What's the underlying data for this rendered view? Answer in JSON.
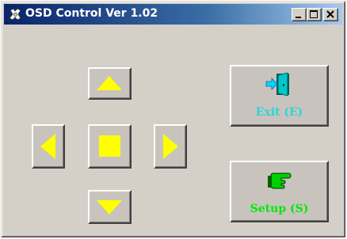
{
  "window": {
    "title": "OSD Control  Ver 1.02",
    "icon": "osd-app-icon"
  },
  "caption_buttons": [
    {
      "name": "minimize",
      "icon": "minimize-icon"
    },
    {
      "name": "maximize",
      "icon": "maximize-icon"
    },
    {
      "name": "close",
      "icon": "close-icon"
    }
  ],
  "dpad": {
    "up": {
      "icon": "triangle-up-icon"
    },
    "left": {
      "icon": "triangle-left-icon"
    },
    "center": {
      "icon": "square-icon"
    },
    "right": {
      "icon": "triangle-right-icon"
    },
    "down": {
      "icon": "triangle-down-icon"
    },
    "arrow_color": "#ffff00"
  },
  "exit_button": {
    "label": "Exit (E)",
    "label_color": "#29d6d6",
    "icon": "exit-door-icon"
  },
  "setup_button": {
    "label": "Setup (S)",
    "label_color": "#00e800",
    "icon": "pointing-hand-icon"
  },
  "colors": {
    "face": "#d4d0c8",
    "title_bar_start": "#0a246a",
    "title_bar_end": "#a6caf0"
  }
}
